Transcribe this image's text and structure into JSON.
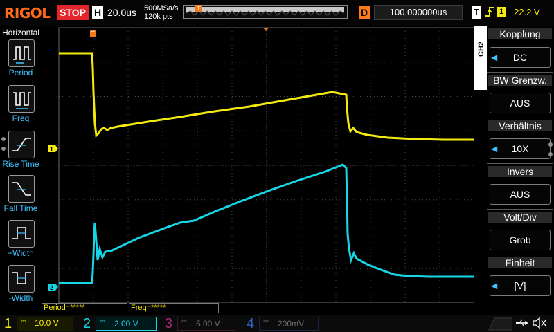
{
  "brand": "RIGOL",
  "run_state": "STOP",
  "timebase": {
    "badge": "H",
    "value": "20.0us",
    "sample_rate": "500MSa/s",
    "memory_depth": "120k pts",
    "trigger_marker": "T"
  },
  "delay": {
    "badge": "D",
    "value": "100.000000us"
  },
  "trigger": {
    "badge": "T",
    "slope_icon": "rising-edge",
    "source": "1",
    "level": "22.2 V"
  },
  "left_menu": {
    "title": "Horizontal",
    "items": [
      {
        "label": "Period",
        "icon": "period-icon"
      },
      {
        "label": "Freq",
        "icon": "freq-icon"
      },
      {
        "label": "Rise Time",
        "icon": "rise-time-icon"
      },
      {
        "label": "Fall Time",
        "icon": "fall-time-icon"
      },
      {
        "label": "+Width",
        "icon": "positive-width-icon"
      },
      {
        "label": "-Width",
        "icon": "negative-width-icon"
      }
    ]
  },
  "right_menu": {
    "channel_tag": "CH2",
    "items": [
      {
        "title": "Kopplung",
        "value": "DC",
        "arrow": true
      },
      {
        "title": "BW Grenzw.",
        "value": "AUS",
        "arrow": false
      },
      {
        "title": "Verhältnis",
        "value": "10X",
        "arrow": true
      },
      {
        "title": "Invers",
        "value": "AUS",
        "arrow": false
      },
      {
        "title": "Volt/Div",
        "value": "Grob",
        "arrow": false
      },
      {
        "title": "Einheit",
        "value": "[V]",
        "arrow": true
      }
    ]
  },
  "measurements": {
    "period": "Period=*****",
    "freq": "Freq=*****"
  },
  "channel_markers": {
    "ch1": "1",
    "ch2": "2"
  },
  "channels": [
    {
      "number": "1",
      "scale": "10.0 V",
      "color": "#f4ea0e",
      "active": true
    },
    {
      "number": "2",
      "scale": "2.00 V",
      "color": "#16d6e6",
      "active": true
    },
    {
      "number": "3",
      "scale": "5.00 V",
      "color": "#b0287a",
      "active": false
    },
    {
      "number": "4",
      "scale": "200mV",
      "color": "#2f5fc0",
      "active": false
    }
  ],
  "colors": {
    "ch1": "#f4ea0e",
    "ch2": "#16d6e6",
    "accent": "#ff6a1a",
    "stop": "#e3262b",
    "menu_label": "#3fc2ff"
  },
  "status_icons": [
    "usb-icon",
    "sound-icon"
  ]
}
